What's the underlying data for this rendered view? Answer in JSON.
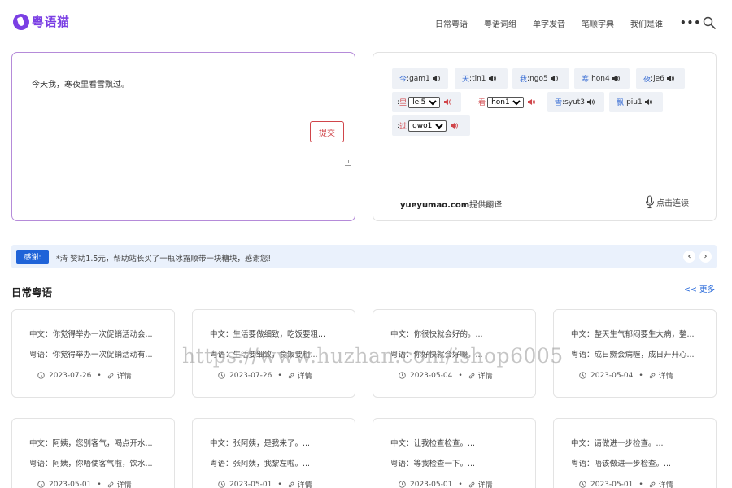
{
  "header": {
    "logo_text": "粤语猫",
    "nav": [
      {
        "label": "日常粤语"
      },
      {
        "label": "粤语词组"
      },
      {
        "label": "单字发音"
      },
      {
        "label": "笔顺字典"
      },
      {
        "label": "我们是谁"
      }
    ],
    "more": "•••",
    "search_icon": "search-icon",
    "brand_color": "#7b3fe4"
  },
  "input": {
    "text": "今天我，寒夜里看雪飘过。",
    "submit_label": "提交"
  },
  "result": {
    "chips": [
      {
        "hz": "今",
        "sep": ": ",
        "py": "gam1"
      },
      {
        "hz": "天",
        "sep": ": ",
        "py": "tin1"
      },
      {
        "hz": "我",
        "sep": ": ",
        "py": "ngo5"
      },
      {
        "hz": "寒",
        "sep": ": ",
        "py": "hon4"
      },
      {
        "hz": "夜",
        "sep": ": ",
        "py": "je6"
      },
      {
        "hz": "里",
        "prefix": ": ",
        "select": "lei5"
      },
      {
        "hz": "看",
        "prefix": ": ",
        "select": "hon1"
      },
      {
        "hz": "雪",
        "sep": ": ",
        "py": "syut3"
      },
      {
        "hz": "飘",
        "sep": ": ",
        "py": "piu1"
      },
      {
        "hz": "过",
        "prefix": ": ",
        "select": "gwo1"
      }
    ],
    "provider_brand": "yueyumao.com",
    "provider_suffix": "提供翻译",
    "read_label": "点击连读"
  },
  "notice": {
    "badge": "感谢:",
    "text": "*清 赞助1.5元，帮助站长买了一瓶冰露顺带一块糖块，感谢您!",
    "prev": "‹",
    "next": "›"
  },
  "section": {
    "title": "日常粤语",
    "more": "<< 更多"
  },
  "cards": [
    {
      "zh": "中文：你觉得举办一次促销活动会...",
      "yue": "粤语：你觉得举办一次促销活动有...",
      "date": "2023-07-26",
      "detail": "详情"
    },
    {
      "zh": "中文：生活要做细致，吃饭要粗...",
      "yue": "粤语：生活要细致，食饭要粗...",
      "date": "2023-07-26",
      "detail": "详情"
    },
    {
      "zh": "中文：你很快就会好的。...",
      "yue": "粤语：你好快就会好嘅。...",
      "date": "2023-05-04",
      "detail": "详情"
    },
    {
      "zh": "中文：整天生气郁闷要生大病，整...",
      "yue": "粤语：成日嬲会病喔，成日开开心...",
      "date": "2023-05-04",
      "detail": "详情"
    },
    {
      "zh": "中文：阿姨，您别客气，喝点开水...",
      "yue": "粤语：阿姨，你唔使客气啦，饮水...",
      "date": "2023-05-01",
      "detail": "详情"
    },
    {
      "zh": "中文：张阿姨，是我来了。...",
      "yue": "粤语：张阿姨，我黎左啦。...",
      "date": "2023-05-01",
      "detail": "详情"
    },
    {
      "zh": "中文：让我检查检查。...",
      "yue": "粤语：等我检查一下。...",
      "date": "2023-05-01",
      "detail": "详情"
    },
    {
      "zh": "中文：请做进一步检查。...",
      "yue": "粤语：唔该做进一步检查。...",
      "date": "2023-05-01",
      "detail": "详情"
    }
  ],
  "watermark": "https://www.huzhan.com/ishop6005",
  "colors": {
    "accent": "#1f63d8",
    "danger": "#d0454a",
    "pinyin": "#3a6ed4"
  }
}
